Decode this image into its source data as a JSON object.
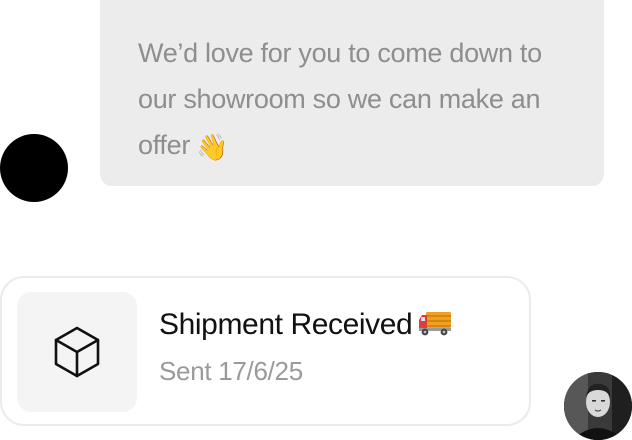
{
  "incoming_message": {
    "text": "We’d love for you to come down to our showroom  so we can make an offer",
    "emoji": "👋"
  },
  "shipment_card": {
    "title": "Shipment Received",
    "subtitle": "Sent 17/6/25",
    "tile_icon": "box-icon",
    "title_icon": "delivery-truck-icon"
  },
  "colors": {
    "bubble_bg": "#ececec",
    "bubble_text": "#8e8e8e",
    "card_border": "#ebebeb",
    "tile_bg": "#f4f4f4",
    "title_text": "#111111",
    "subtitle_text": "#9a9a9a"
  }
}
